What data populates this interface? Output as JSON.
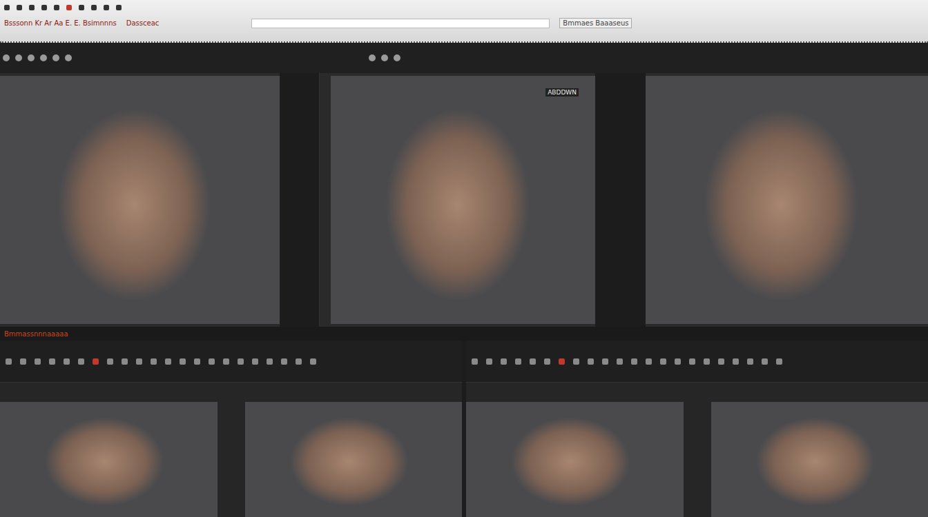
{
  "menu_bar": {
    "texts": [
      "Bsssonn Kr Ar Aa E. E. Bsimnnns",
      "Dassceac"
    ],
    "field_label": "Bmmaes Baaaseus"
  },
  "viewports_top": [
    {
      "name": "front-view",
      "annotation": ""
    },
    {
      "name": "side-view",
      "annotation": "ABDDWN"
    },
    {
      "name": "right-view",
      "annotation": ""
    }
  ],
  "status_text": "Bmmassnnnaaaaa",
  "viewports_bottom": [
    {
      "name": "view-a"
    },
    {
      "name": "view-b"
    },
    {
      "name": "view-c"
    },
    {
      "name": "view-d"
    }
  ]
}
